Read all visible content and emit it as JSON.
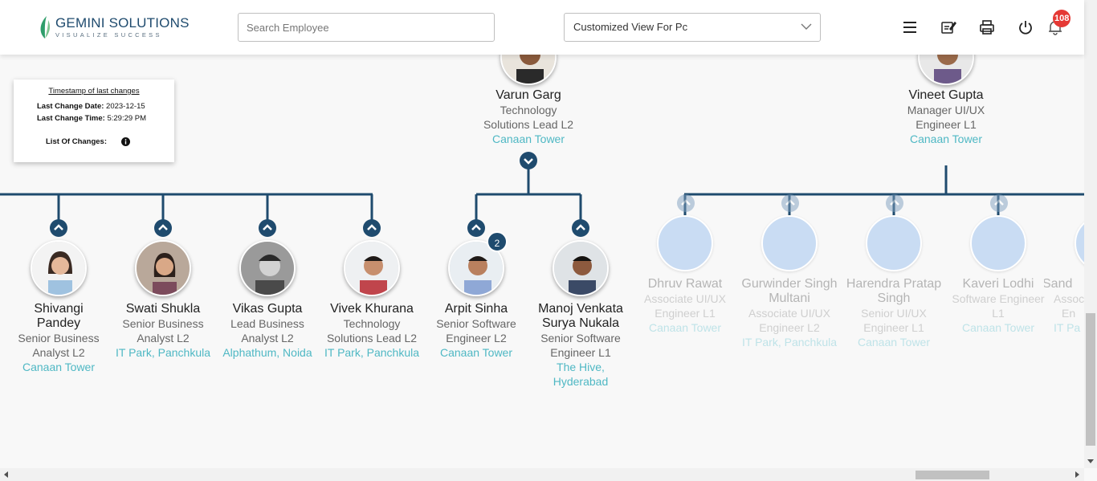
{
  "header": {
    "logo_title": "GEMINI SOLUTIONS",
    "logo_tagline": "VISUALIZE SUCCESS",
    "search_placeholder": "Search Employee",
    "view_selected": "Customized View For Pc",
    "notification_count": "108",
    "icons": [
      "menu-icon",
      "edit-note-icon",
      "print-icon",
      "power-icon",
      "bell-icon"
    ]
  },
  "timestamp_card": {
    "title": "Timestamp of last changes",
    "date_label": "Last Change Date:",
    "date_value": "2023-12-15",
    "time_label": "Last Change Time:",
    "time_value": "5:29:29 PM",
    "changes_label": "List Of Changes:"
  },
  "colors": {
    "brand": "#1f4b6e",
    "location": "#4fb8c4",
    "notification": "#e53935",
    "placeholder_avatar": "#c9dcf3"
  },
  "managers": [
    {
      "name": "Varun Garg",
      "role": [
        "Technology",
        "Solutions Lead L2"
      ],
      "location": "Canaan Tower"
    },
    {
      "name": "Vineet Gupta",
      "role": [
        "Manager UI/UX",
        "Engineer L1"
      ],
      "location": "Canaan Tower"
    }
  ],
  "employees": [
    {
      "name": [
        "Shivangi",
        "Pandey"
      ],
      "role": [
        "Senior Business",
        "Analyst L2"
      ],
      "location": [
        "Canaan Tower"
      ]
    },
    {
      "name": [
        "Swati Shukla"
      ],
      "role": [
        "Senior Business",
        "Analyst L2"
      ],
      "location": [
        "IT Park, Panchkula"
      ]
    },
    {
      "name": [
        "Vikas Gupta"
      ],
      "role": [
        "Lead Business",
        "Analyst L2"
      ],
      "location": [
        "Alphathum, Noida"
      ]
    },
    {
      "name": [
        "Vivek Khurana"
      ],
      "role": [
        "Technology",
        "Solutions Lead L2"
      ],
      "location": [
        "IT Park, Panchkula"
      ]
    },
    {
      "name": [
        "Arpit Sinha"
      ],
      "role": [
        "Senior Software",
        "Engineer L2"
      ],
      "location": [
        "Canaan Tower"
      ],
      "reports": "2"
    },
    {
      "name": [
        "Manoj Venkata",
        "Surya Nukala"
      ],
      "role": [
        "Senior Software",
        "Engineer L1"
      ],
      "location": [
        "The Hive,",
        "Hyderabad"
      ]
    },
    {
      "name": [
        "Dhruv Rawat"
      ],
      "role": [
        "Associate UI/UX",
        "Engineer L1"
      ],
      "location": [
        "Canaan Tower"
      ]
    },
    {
      "name": [
        "Gurwinder Singh",
        "Multani"
      ],
      "role": [
        "Associate UI/UX",
        "Engineer L2"
      ],
      "location": [
        "IT Park, Panchkula"
      ]
    },
    {
      "name": [
        "Harendra Pratap",
        "Singh"
      ],
      "role": [
        "Senior UI/UX",
        "Engineer L1"
      ],
      "location": [
        "Canaan Tower"
      ]
    },
    {
      "name": [
        "Kaveri Lodhi"
      ],
      "role": [
        "Software Engineer",
        "L1"
      ],
      "location": [
        "Canaan Tower"
      ]
    },
    {
      "name": [
        "Sand"
      ],
      "role": [
        "Assoc",
        "En"
      ],
      "location": [
        "IT Pa"
      ]
    }
  ]
}
